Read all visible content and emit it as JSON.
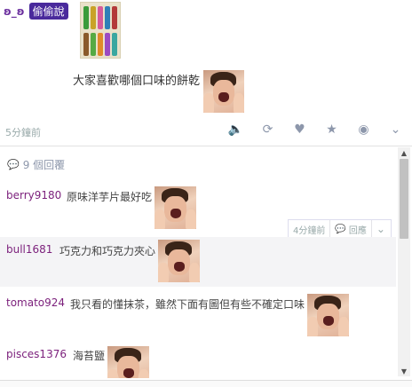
{
  "post": {
    "author": "ʚ_ʚ",
    "tag": "偷偷說",
    "text": "大家喜歡哪個口味的餅乾",
    "time": "5分鐘前",
    "actions": [
      {
        "name": "mute-icon",
        "glyph": "🔈"
      },
      {
        "name": "refresh-icon",
        "glyph": "⟳"
      },
      {
        "name": "heart-icon",
        "glyph": "♥"
      },
      {
        "name": "star-icon",
        "glyph": "★"
      },
      {
        "name": "globe-icon",
        "glyph": "◉"
      },
      {
        "name": "chevron-down-icon",
        "glyph": "⌄"
      }
    ]
  },
  "comments": {
    "count_label": "9 個回覆",
    "items": [
      {
        "user": "berry9180",
        "text": "原味洋芋片最好吃"
      },
      {
        "user": "bull1681",
        "text": "巧克力和巧克力夾心"
      },
      {
        "user": "tomato924",
        "text": "我只看的懂抹茶，雖然下面有圖但有些不確定口味"
      },
      {
        "user": "pisces1376",
        "text": "海苔鹽"
      }
    ],
    "toolbar": {
      "time": "4分鐘前",
      "reply_label": "回應"
    }
  },
  "colors": {
    "accent": "#4a2a9c",
    "username": "#7b1f7b",
    "icon": "#8d97ab"
  }
}
